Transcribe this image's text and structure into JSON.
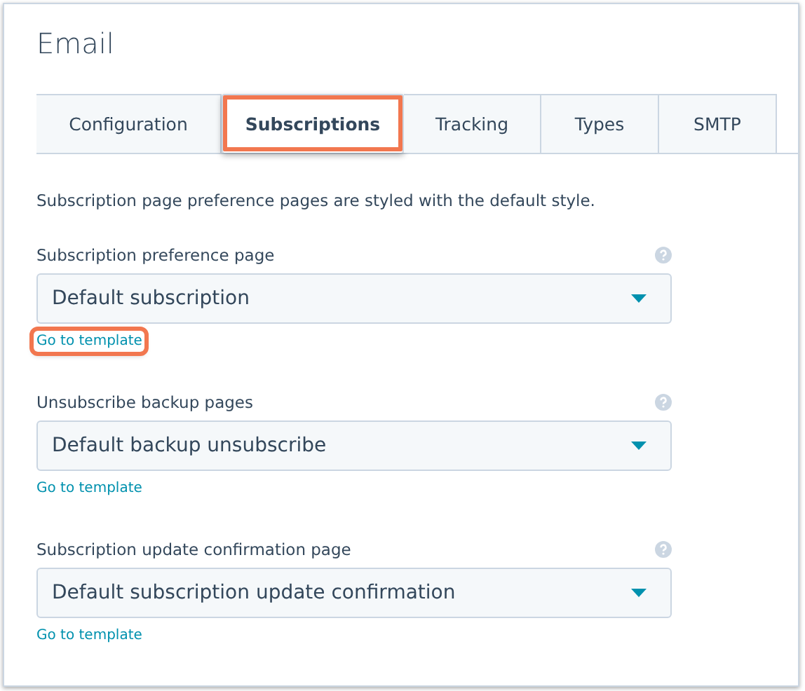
{
  "title": "Email",
  "tabs": [
    {
      "label": "Configuration",
      "selected": false,
      "highlighted": false
    },
    {
      "label": "Subscriptions",
      "selected": true,
      "highlighted": true
    },
    {
      "label": "Tracking",
      "selected": false,
      "highlighted": false
    },
    {
      "label": "Types",
      "selected": false,
      "highlighted": false
    },
    {
      "label": "SMTP",
      "selected": false,
      "highlighted": false
    }
  ],
  "description": "Subscription page preference pages are styled with the default style.",
  "fields": [
    {
      "label": "Subscription preference page",
      "value": "Default subscription",
      "link": "Go to template",
      "link_highlighted": true
    },
    {
      "label": "Unsubscribe backup pages",
      "value": "Default backup unsubscribe",
      "link": "Go to template",
      "link_highlighted": false
    },
    {
      "label": "Subscription update confirmation page",
      "value": "Default subscription update confirmation",
      "link": "Go to template",
      "link_highlighted": false
    }
  ]
}
